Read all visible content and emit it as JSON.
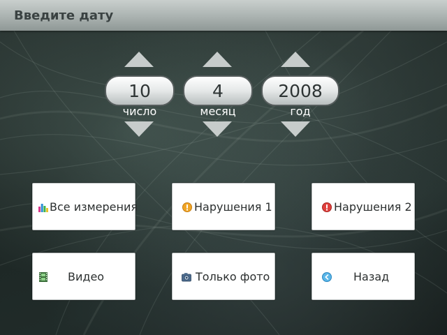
{
  "header": {
    "title": "Введите дату"
  },
  "date": {
    "day": {
      "value": "10",
      "label": "число"
    },
    "month": {
      "value": "4",
      "label": "месяц"
    },
    "year": {
      "value": "2008",
      "label": "год"
    }
  },
  "buttons": {
    "all": {
      "label": "Все измерения",
      "icon": "bar-chart-icon"
    },
    "violations1": {
      "label": "Нарушения 1",
      "icon": "warning-orange-icon"
    },
    "violations2": {
      "label": "Нарушения 2",
      "icon": "alert-red-icon"
    },
    "video": {
      "label": "Видео",
      "icon": "film-icon"
    },
    "photo": {
      "label": "Только фото",
      "icon": "camera-icon"
    },
    "back": {
      "label": "Назад",
      "icon": "back-arrow-icon"
    }
  },
  "colors": {
    "titlebar": "#aab2b0",
    "pill": "#e5e8e8",
    "arrow": "#c7cccb"
  }
}
